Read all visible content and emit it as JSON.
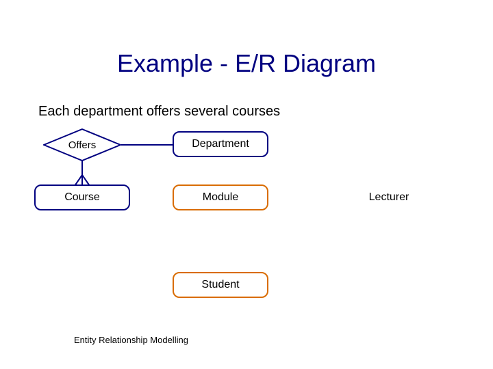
{
  "title": "Example - E/R Diagram",
  "subtitle": "Each department offers several courses",
  "footer": "Entity Relationship Modelling",
  "entities": {
    "department": "Department",
    "course": "Course",
    "module": "Module",
    "lecturer": "Lecturer",
    "student": "Student"
  },
  "relationships": {
    "offers": "Offers"
  },
  "colors": {
    "navy": "#000080",
    "orange": "#d96c00"
  }
}
